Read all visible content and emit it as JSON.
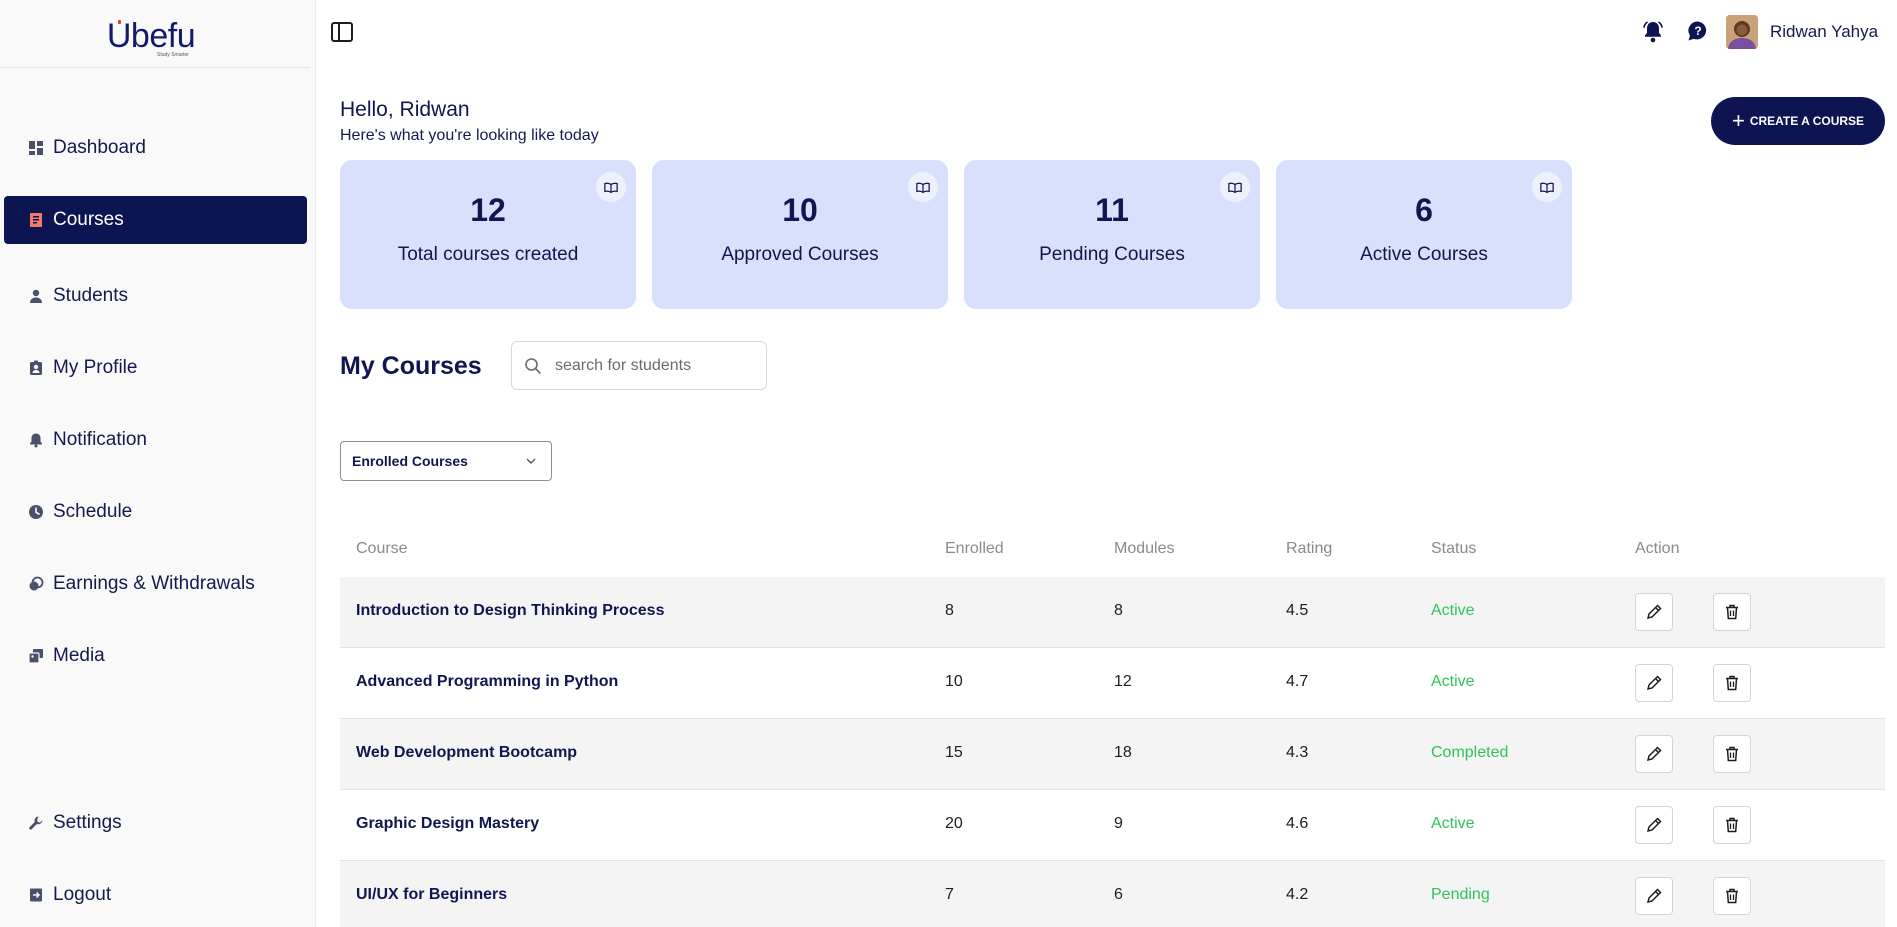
{
  "brand": {
    "name": "Ubefu",
    "tagline": "Study Smarter"
  },
  "sidebar": {
    "items": [
      {
        "label": "Dashboard",
        "icon": "dashboard-icon"
      },
      {
        "label": "Courses",
        "icon": "book-icon",
        "active": true
      },
      {
        "label": "Students",
        "icon": "student-icon"
      },
      {
        "label": "My Profile",
        "icon": "profile-badge-icon"
      },
      {
        "label": "Notification",
        "icon": "bell-icon"
      },
      {
        "label": "Schedule",
        "icon": "clock-icon"
      },
      {
        "label": "Earnings & Withdrawals",
        "icon": "coins-icon"
      },
      {
        "label": "Media",
        "icon": "media-icon"
      }
    ],
    "bottom": [
      {
        "label": "Settings",
        "icon": "wrench-icon"
      },
      {
        "label": "Logout",
        "icon": "logout-icon"
      }
    ],
    "active_color": "#0c1552",
    "active_icon_color": "#f47a6b"
  },
  "topbar": {
    "username": "Ridwan Yahya",
    "icons": [
      "panel-toggle-icon",
      "bell-icon",
      "chat-help-icon",
      "avatar"
    ]
  },
  "greeting": {
    "title": "Hello, Ridwan",
    "subtitle": "Here's what you're looking like today"
  },
  "create_button": {
    "label": "CREATE A COURSE"
  },
  "stats": [
    {
      "value": "12",
      "label": "Total courses created"
    },
    {
      "value": "10",
      "label": "Approved Courses"
    },
    {
      "value": "11",
      "label": "Pending Courses"
    },
    {
      "value": "6",
      "label": "Active Courses"
    }
  ],
  "my_courses": {
    "title": "My Courses",
    "search_placeholder": "search for students",
    "filter": {
      "selected": "Enrolled Courses"
    }
  },
  "table": {
    "headers": {
      "course": "Course",
      "enrolled": "Enrolled",
      "modules": "Modules",
      "rating": "Rating",
      "status": "Status",
      "action": "Action"
    },
    "rows": [
      {
        "course": "Introduction to Design Thinking Process",
        "enrolled": "8",
        "modules": "8",
        "rating": "4.5",
        "status": "Active"
      },
      {
        "course": "Advanced Programming in Python",
        "enrolled": "10",
        "modules": "12",
        "rating": "4.7",
        "status": "Active"
      },
      {
        "course": "Web Development Bootcamp",
        "enrolled": "15",
        "modules": "18",
        "rating": "4.3",
        "status": "Completed"
      },
      {
        "course": "Graphic Design Mastery",
        "enrolled": "20",
        "modules": "9",
        "rating": "4.6",
        "status": "Active"
      },
      {
        "course": "UI/UX for Beginners",
        "enrolled": "7",
        "modules": "6",
        "rating": "4.2",
        "status": "Pending"
      }
    ],
    "status_color": "#2ec35a"
  }
}
